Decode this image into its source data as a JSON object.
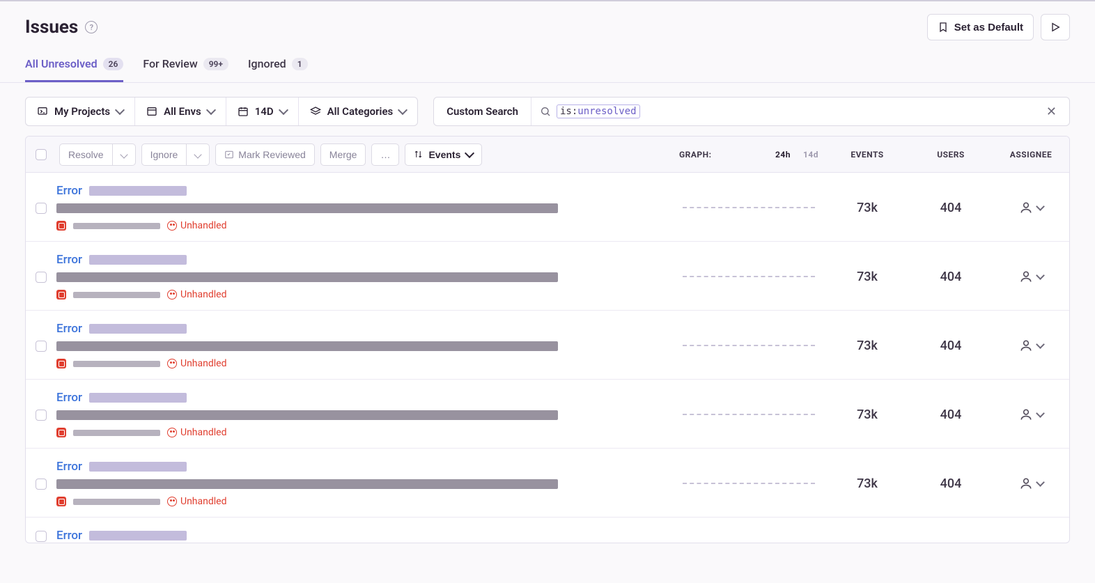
{
  "header": {
    "title": "Issues",
    "set_default_label": "Set as Default"
  },
  "tabs": [
    {
      "label": "All Unresolved",
      "count": "26",
      "active": true
    },
    {
      "label": "For Review",
      "count": "99+",
      "active": false
    },
    {
      "label": "Ignored",
      "count": "1",
      "active": false
    }
  ],
  "filters": {
    "projects": "My Projects",
    "envs": "All Envs",
    "time": "14D",
    "categories": "All Categories",
    "search_label": "Custom Search",
    "query_key": "is:",
    "query_value": "unresolved"
  },
  "columns": {
    "resolve": "Resolve",
    "ignore": "Ignore",
    "mark_reviewed": "Mark Reviewed",
    "merge": "Merge",
    "more": "…",
    "sort_label": "Events",
    "graph_label": "GRAPH:",
    "graph_24h": "24h",
    "graph_14d": "14d",
    "events": "EVENTS",
    "users": "USERS",
    "assignee": "ASSIGNEE"
  },
  "issues": [
    {
      "title": "Error",
      "unhandled": "Unhandled",
      "events": "73k",
      "users": "404"
    },
    {
      "title": "Error",
      "unhandled": "Unhandled",
      "events": "73k",
      "users": "404"
    },
    {
      "title": "Error",
      "unhandled": "Unhandled",
      "events": "73k",
      "users": "404"
    },
    {
      "title": "Error",
      "unhandled": "Unhandled",
      "events": "73k",
      "users": "404"
    },
    {
      "title": "Error",
      "unhandled": "Unhandled",
      "events": "73k",
      "users": "404"
    },
    {
      "title": "Error",
      "unhandled": "",
      "events": "",
      "users": "",
      "partial": true
    }
  ]
}
